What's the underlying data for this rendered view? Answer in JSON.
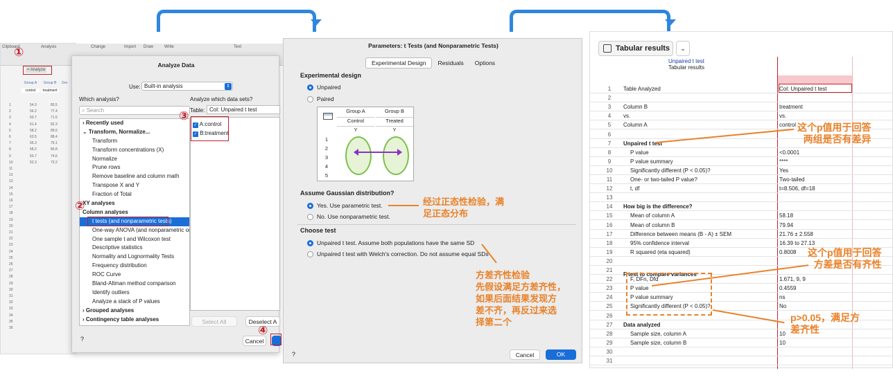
{
  "connectors": {
    "arrow1": "arrow",
    "arrow2": "arrow"
  },
  "prism": {
    "ribbon": {
      "clipboard": "Clipboard",
      "analysis": "Analysis",
      "change": "Change",
      "import": "Import",
      "draw": "Draw",
      "write": "Write",
      "text": "Text",
      "analyze_btn": "= Analyze"
    },
    "cols": {
      "a": "Group A",
      "b": "Group B",
      "c": "Gro",
      "a_sub": "control",
      "b_sub": "treatment"
    },
    "rows": [
      [
        "1",
        "54.3",
        "85.5"
      ],
      [
        "2",
        "56.2",
        "77.4"
      ],
      [
        "3",
        "60.7",
        "71.5"
      ],
      [
        "4",
        "61.4",
        "82.3"
      ],
      [
        "5",
        "58.2",
        "89.6"
      ],
      [
        "6",
        "63.5",
        "88.4"
      ],
      [
        "7",
        "66.3",
        "76.1"
      ],
      [
        "8",
        "58.2",
        "80.8"
      ],
      [
        "9",
        "50.7",
        "74.6"
      ],
      [
        "10",
        "52.3",
        "73.2"
      ]
    ],
    "empty_rows": [
      "11",
      "12",
      "13",
      "14",
      "15",
      "16",
      "17",
      "18",
      "19",
      "20",
      "21",
      "22",
      "23",
      "24",
      "25",
      "26",
      "27",
      "28",
      "29",
      "30",
      "31",
      "32",
      "33",
      "34",
      "35",
      "36"
    ]
  },
  "analyze": {
    "title": "Analyze Data",
    "use_label": "Use:",
    "use_value": "Built-in analysis",
    "which_label": "Which analysis?",
    "search_placeholder": "Search",
    "tree": [
      {
        "t": "› Recently used",
        "b": true
      },
      {
        "t": "⌄ Transform, Normalize...",
        "b": true
      },
      {
        "t": "Transform",
        "i": 1
      },
      {
        "t": "Transform concentrations (X)",
        "i": 1
      },
      {
        "t": "Normalize",
        "i": 1
      },
      {
        "t": "Prune rows",
        "i": 1
      },
      {
        "t": "Remove baseline and column math",
        "i": 1
      },
      {
        "t": "Transpose X and Y",
        "i": 1
      },
      {
        "t": "Fraction of Total",
        "i": 1
      },
      {
        "t": "XY analyses",
        "b": true
      },
      {
        "t": "Column analyses",
        "b": true
      },
      {
        "t": "t tests (and nonparametric tests)",
        "i": 1,
        "sel": true
      },
      {
        "t": "One-way ANOVA (and nonparametric or m",
        "i": 1
      },
      {
        "t": "One sample t and Wilcoxon test",
        "i": 1
      },
      {
        "t": "Descriptive statistics",
        "i": 1
      },
      {
        "t": "Normality and Lognormality Tests",
        "i": 1
      },
      {
        "t": "Frequency distribution",
        "i": 1
      },
      {
        "t": "ROC Curve",
        "i": 1
      },
      {
        "t": "Bland-Altman method comparison",
        "i": 1
      },
      {
        "t": "Identify outliers",
        "i": 1
      },
      {
        "t": "Analyze a stack of P values",
        "i": 1
      },
      {
        "t": "› Grouped analyses",
        "b": true
      },
      {
        "t": "› Contingency table analyses",
        "b": true
      }
    ],
    "datasets_label": "Analyze which data sets?",
    "table_label": "Table:",
    "table_value": "Col: Unpaired t test",
    "datasets": [
      "A:control",
      "B:treatment"
    ],
    "select_all": "Select All",
    "deselect_all": "Deselect A",
    "help": "?",
    "cancel": "Cancel"
  },
  "params": {
    "title": "Parameters: t Tests (and Nonparametric Tests)",
    "tabs": [
      "Experimental Design",
      "Residuals",
      "Options"
    ],
    "exp_design": "Experimental design",
    "unpaired": "Unpaired",
    "paired": "Paired",
    "grid": {
      "ha": "Group A",
      "hb": "Group B",
      "sa": "Control",
      "sb": "Treated",
      "ya": "Y",
      "yb": "Y",
      "rows": [
        "1",
        "2",
        "3",
        "4",
        "5"
      ]
    },
    "gauss_title": "Assume Gaussian distribution?",
    "gauss_yes": "Yes. Use parametric test.",
    "gauss_no": "No. Use nonparametric test.",
    "choose_title": "Choose test",
    "test1": "Unpaired t test. Assume both populations have the same SD",
    "test2": "Unpaired t test with Welch's correction. Do not assume equal SDs",
    "help": "?",
    "cancel": "Cancel",
    "ok": "OK"
  },
  "results": {
    "tab_title": "Tabular results",
    "header_link": "Unpaired t test",
    "header_sub": "Tabular results",
    "rows": [
      [
        "1",
        "Table Analyzed",
        "Col: Unpaired t test"
      ],
      [
        "2",
        "",
        ""
      ],
      [
        "3",
        "Column B",
        "treatment"
      ],
      [
        "4",
        "vs.",
        "vs."
      ],
      [
        "5",
        "Column A",
        "control"
      ],
      [
        "6",
        "",
        ""
      ],
      [
        "7",
        "Unpaired t test",
        ""
      ],
      [
        "8",
        "P value",
        "<0.0001"
      ],
      [
        "9",
        "P value summary",
        "****"
      ],
      [
        "10",
        "Significantly different (P < 0.05)?",
        "Yes"
      ],
      [
        "11",
        "One- or two-tailed P value?",
        "Two-tailed"
      ],
      [
        "12",
        "t, df",
        "t=8.506, df=18"
      ],
      [
        "13",
        "",
        ""
      ],
      [
        "14",
        "How big is the difference?",
        ""
      ],
      [
        "15",
        "Mean of column A",
        "58.18"
      ],
      [
        "16",
        "Mean of column B",
        "79.94"
      ],
      [
        "17",
        "Difference between means (B - A) ± SEM",
        "21.76 ± 2.558"
      ],
      [
        "18",
        "95% confidence interval",
        "16.39 to 27.13"
      ],
      [
        "19",
        "R squared (eta squared)",
        "0.8008"
      ],
      [
        "20",
        "",
        ""
      ],
      [
        "21",
        "",
        ""
      ],
      [
        "22",
        "F, DFn, Dfd",
        "1.671, 9, 9"
      ],
      [
        "23",
        "P value",
        "0.4559"
      ],
      [
        "24",
        "P value summary",
        "ns"
      ],
      [
        "25",
        "Significantly different (P < 0.05)?",
        "No"
      ],
      [
        "26",
        "",
        ""
      ],
      [
        "27",
        "Data analyzed",
        ""
      ],
      [
        "28",
        "Sample size, column A",
        "10"
      ],
      [
        "29",
        "Sample size, column B",
        "10"
      ],
      [
        "30",
        "",
        ""
      ],
      [
        "31",
        "",
        ""
      ]
    ],
    "ftest_title": "F test to compare variances"
  },
  "annotations": {
    "n1": "①",
    "n2": "②",
    "n3": "③",
    "n4": "④",
    "normality_1": "经过正态性检验，满",
    "normality_2": "足正态分布",
    "var_1": "方差齐性检验",
    "var_2": "先假设满足方差齐性，",
    "var_3": "如果后面结果发现方",
    "var_4": "差不齐，再反过来选",
    "var_5": "择第二个",
    "p1_1": "这个p值用于回答",
    "p1_2": "两组是否有差异",
    "p2_1": "这个p值用于回答",
    "p2_2": "方差是否有齐性",
    "p3_1": "p>0.05，满足方",
    "p3_2": "差齐性"
  },
  "colors": {
    "accent": "#1a6ed8",
    "annotation": "#e8822a",
    "marker": "#c0202a",
    "connector": "#2e86de"
  }
}
